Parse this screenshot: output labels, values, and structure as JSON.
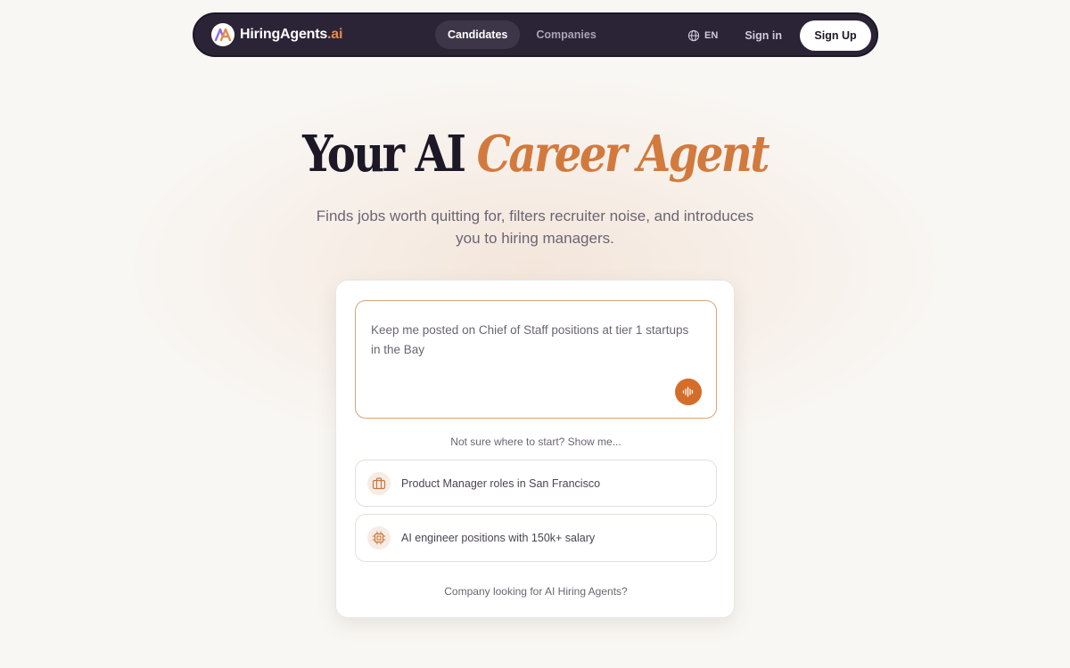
{
  "brand": {
    "name": "HiringAgents",
    "tld": ".ai",
    "logo_icon": "ha-monogram-icon"
  },
  "nav": {
    "tabs": [
      {
        "label": "Candidates",
        "active": true
      },
      {
        "label": "Companies",
        "active": false
      }
    ],
    "language": {
      "label": "EN",
      "icon": "globe-icon"
    },
    "sign_in": "Sign in",
    "sign_up": "Sign Up"
  },
  "hero": {
    "title_plain": "Your AI",
    "title_accent": "Career Agent",
    "subtitle": "Finds jobs worth quitting for, filters recruiter noise, and introduces you to hiring managers."
  },
  "prompt": {
    "value": "Keep me posted on Chief of Staff positions at tier 1 startups in the Bay",
    "voice_icon": "audio-wave-icon"
  },
  "hint": "Not sure where to start? Show me...",
  "suggestions": [
    {
      "label": "Product Manager roles in San Francisco",
      "icon": "briefcase-icon"
    },
    {
      "label": "AI engineer positions with 150k+ salary",
      "icon": "chip-icon"
    }
  ],
  "company_link": "Company looking for AI Hiring Agents?",
  "colors": {
    "nav_bg": "#2b2437",
    "accent": "#d27a3e",
    "voice_button": "#d46d2a",
    "page_bg": "#f9f7f4"
  }
}
